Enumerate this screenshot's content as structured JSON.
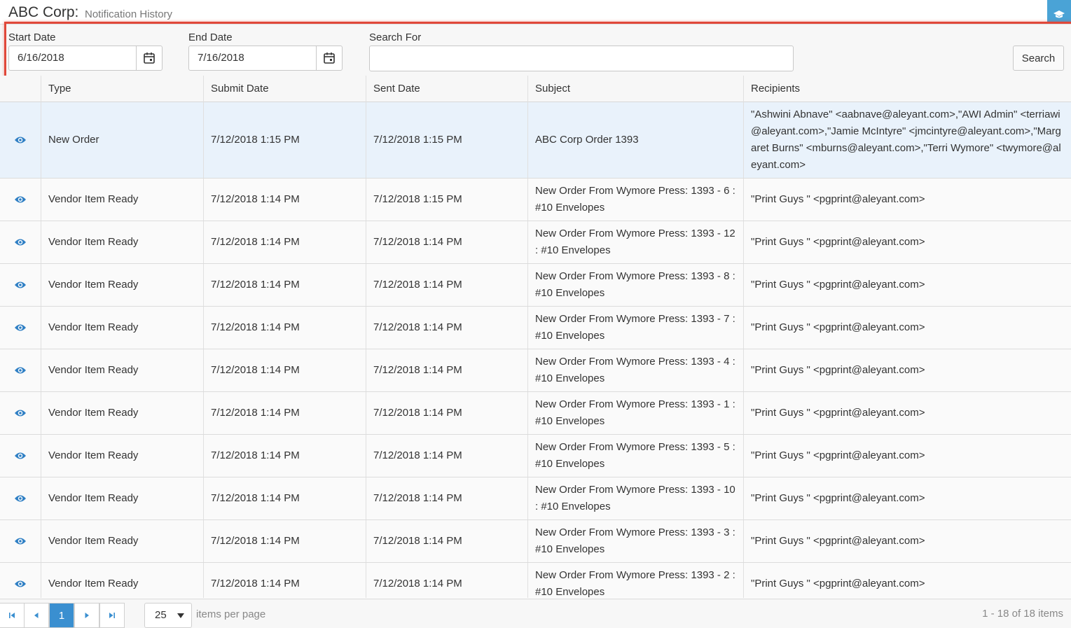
{
  "header": {
    "company": "ABC Corp:",
    "subtitle": "Notification History",
    "corner_icon": "graduation-cap-icon"
  },
  "filters": {
    "start_label": "Start Date",
    "start_value": "6/16/2018",
    "end_label": "End Date",
    "end_value": "7/16/2018",
    "search_label": "Search For",
    "search_value": "",
    "search_button": "Search",
    "calendar_icon": "calendar-icon"
  },
  "columns": [
    "Type",
    "Submit Date",
    "Sent Date",
    "Subject",
    "Recipients"
  ],
  "rows": [
    {
      "type": "New Order",
      "submit": "7/12/2018 1:15 PM",
      "sent": "7/12/2018 1:15 PM",
      "subject": "ABC Corp Order 1393",
      "recipients": "\"Ashwini Abnave\" <aabnave@aleyant.com>,\"AWI Admin\" <terriawi@aleyant.com>,\"Jamie McIntyre\" <jmcintyre@aleyant.com>,\"Margaret Burns\" <mburns@aleyant.com>,\"Terri Wymore\" <twymore@aleyant.com>",
      "selected": true
    },
    {
      "type": "Vendor Item Ready",
      "submit": "7/12/2018 1:14 PM",
      "sent": "7/12/2018 1:15 PM",
      "subject": "New Order From Wymore Press: 1393 - 6 : #10 Envelopes",
      "recipients": "\"Print Guys \" <pgprint@aleyant.com>"
    },
    {
      "type": "Vendor Item Ready",
      "submit": "7/12/2018 1:14 PM",
      "sent": "7/12/2018 1:14 PM",
      "subject": "New Order From Wymore Press: 1393 - 12 : #10 Envelopes",
      "recipients": "\"Print Guys \" <pgprint@aleyant.com>"
    },
    {
      "type": "Vendor Item Ready",
      "submit": "7/12/2018 1:14 PM",
      "sent": "7/12/2018 1:14 PM",
      "subject": "New Order From Wymore Press: 1393 - 8 : #10 Envelopes",
      "recipients": "\"Print Guys \" <pgprint@aleyant.com>"
    },
    {
      "type": "Vendor Item Ready",
      "submit": "7/12/2018 1:14 PM",
      "sent": "7/12/2018 1:14 PM",
      "subject": "New Order From Wymore Press: 1393 - 7 : #10 Envelopes",
      "recipients": "\"Print Guys \" <pgprint@aleyant.com>"
    },
    {
      "type": "Vendor Item Ready",
      "submit": "7/12/2018 1:14 PM",
      "sent": "7/12/2018 1:14 PM",
      "subject": "New Order From Wymore Press: 1393 - 4 : #10 Envelopes",
      "recipients": "\"Print Guys \" <pgprint@aleyant.com>"
    },
    {
      "type": "Vendor Item Ready",
      "submit": "7/12/2018 1:14 PM",
      "sent": "7/12/2018 1:14 PM",
      "subject": "New Order From Wymore Press: 1393 - 1 : #10 Envelopes",
      "recipients": "\"Print Guys \" <pgprint@aleyant.com>"
    },
    {
      "type": "Vendor Item Ready",
      "submit": "7/12/2018 1:14 PM",
      "sent": "7/12/2018 1:14 PM",
      "subject": "New Order From Wymore Press: 1393 - 5 : #10 Envelopes",
      "recipients": "\"Print Guys \" <pgprint@aleyant.com>"
    },
    {
      "type": "Vendor Item Ready",
      "submit": "7/12/2018 1:14 PM",
      "sent": "7/12/2018 1:14 PM",
      "subject": "New Order From Wymore Press: 1393 - 10 : #10 Envelopes",
      "recipients": "\"Print Guys \" <pgprint@aleyant.com>"
    },
    {
      "type": "Vendor Item Ready",
      "submit": "7/12/2018 1:14 PM",
      "sent": "7/12/2018 1:14 PM",
      "subject": "New Order From Wymore Press: 1393 - 3 : #10 Envelopes",
      "recipients": "\"Print Guys \" <pgprint@aleyant.com>"
    },
    {
      "type": "Vendor Item Ready",
      "submit": "7/12/2018 1:14 PM",
      "sent": "7/12/2018 1:14 PM",
      "subject": "New Order From Wymore Press: 1393 - 2 : #10 Envelopes",
      "recipients": "\"Print Guys \" <pgprint@aleyant.com>"
    }
  ],
  "row_icon": "eye-icon",
  "pager": {
    "first_icon": "first-page-icon",
    "prev_icon": "prev-page-icon",
    "next_icon": "next-page-icon",
    "last_icon": "last-page-icon",
    "current_page": "1",
    "page_size": "25",
    "items_per_page": "items per page",
    "info": "1 - 18 of 18 items"
  },
  "colors": {
    "accent": "#3a8fd0",
    "highlight_border": "#e0483a",
    "selected_row": "#e9f2fb"
  }
}
